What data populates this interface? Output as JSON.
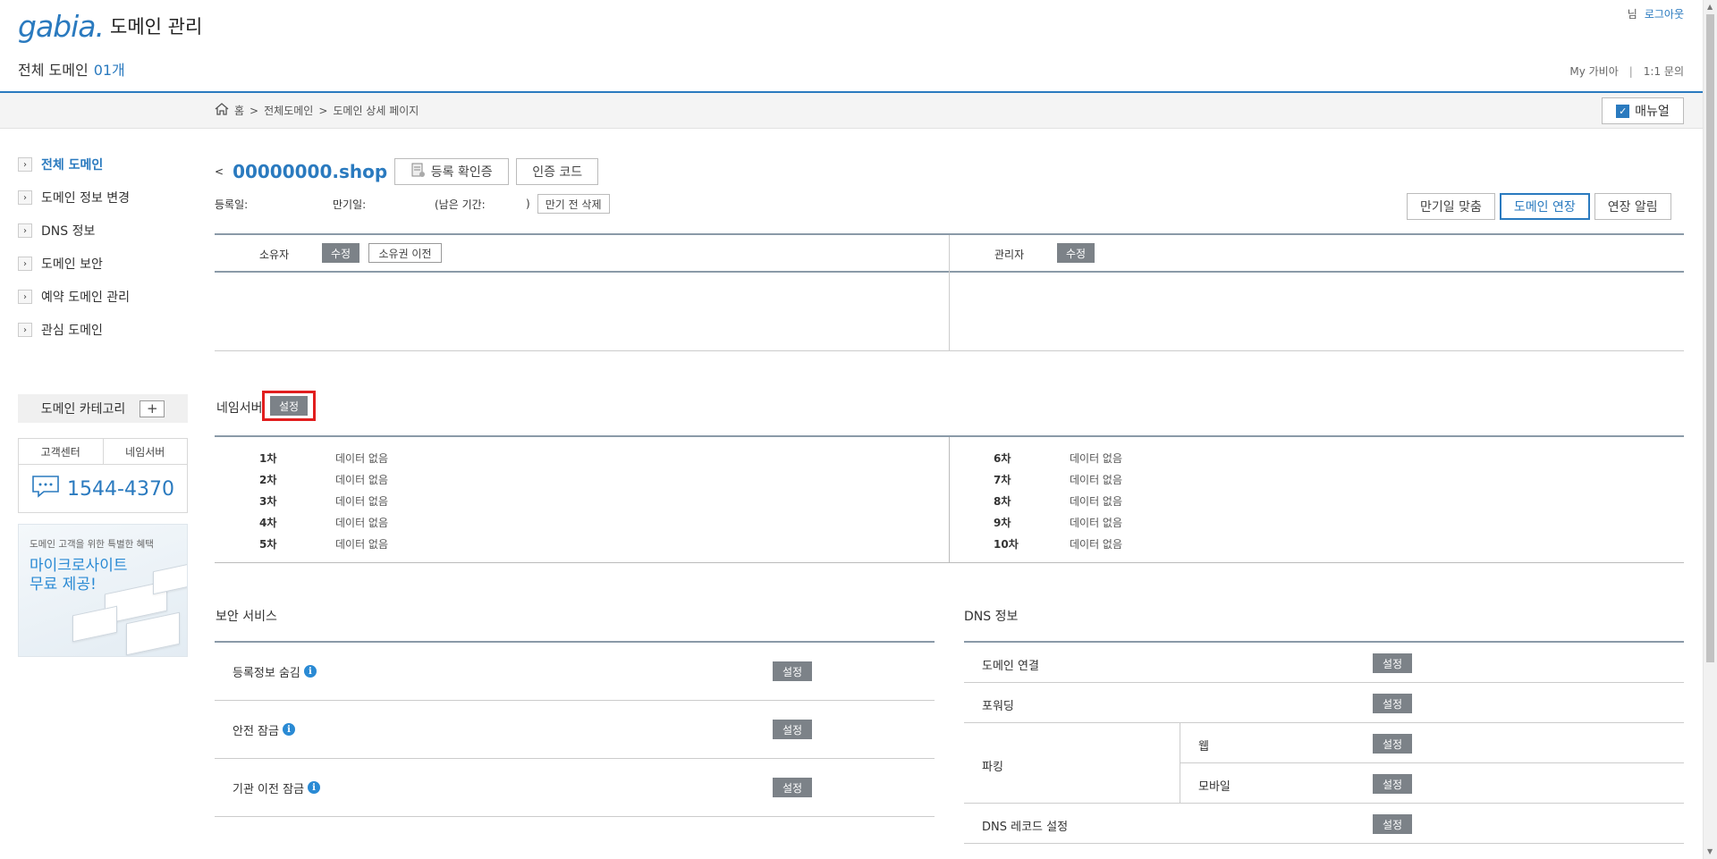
{
  "header": {
    "logo_text": "gabia.",
    "app_title": "도메인 관리",
    "count_label": "전체 도메인",
    "count_value": "01개",
    "user_suffix": "님",
    "logout": "로그아웃",
    "links": [
      "My 가비아",
      "|",
      "1:1 문의"
    ]
  },
  "breadcrumb": {
    "items": [
      "홈",
      ">",
      "전체도메인",
      ">",
      "도메인 상세 페이지"
    ],
    "manual_label": "매뉴얼"
  },
  "sidebar": {
    "items": [
      {
        "label": "전체 도메인"
      },
      {
        "label": "도메인 정보 변경"
      },
      {
        "label": "DNS 정보"
      },
      {
        "label": "도메인 보안"
      },
      {
        "label": "예약 도메인 관리"
      },
      {
        "label": "관심 도메인"
      }
    ],
    "category_label": "도메인 카테고리",
    "category_add": "+",
    "cs_tabs": [
      "고객센터",
      "네임서버"
    ],
    "phone": "1544-4370",
    "promo_small": "도메인 고객을 위한 특별한 혜택",
    "promo_title": "마이크로사이트 무료 제공!"
  },
  "domain": {
    "back": "<",
    "name": "00000000.shop",
    "cert_btn": "등록 확인증",
    "code_btn": "인증 코드",
    "reg_label": "등록일:",
    "exp_label": "만기일:",
    "remain_open": "(남은 기간:",
    "remain_close": ")",
    "delete_btn": "만기 전 삭제",
    "actions": [
      "만기일 맞춤",
      "도메인 연장",
      "연장 알림"
    ]
  },
  "contacts": {
    "owner_label": "소유자",
    "owner_edit": "수정",
    "owner_transfer": "소유권 이전",
    "admin_label": "관리자",
    "admin_edit": "수정"
  },
  "nameserver": {
    "title": "네임서버",
    "set_btn": "설정",
    "left": [
      {
        "idx": "1차",
        "value": "데이터 없음"
      },
      {
        "idx": "2차",
        "value": "데이터 없음"
      },
      {
        "idx": "3차",
        "value": "데이터 없음"
      },
      {
        "idx": "4차",
        "value": "데이터 없음"
      },
      {
        "idx": "5차",
        "value": "데이터 없음"
      }
    ],
    "right": [
      {
        "idx": "6차",
        "value": "데이터 없음"
      },
      {
        "idx": "7차",
        "value": "데이터 없음"
      },
      {
        "idx": "8차",
        "value": "데이터 없음"
      },
      {
        "idx": "9차",
        "value": "데이터 없음"
      },
      {
        "idx": "10차",
        "value": "데이터 없음"
      }
    ]
  },
  "security": {
    "title": "보안 서비스",
    "rows": [
      {
        "label": "등록정보 숨김",
        "btn": "설정"
      },
      {
        "label": "안전 잠금",
        "btn": "설정"
      },
      {
        "label": "기관 이전 잠금",
        "btn": "설정"
      }
    ],
    "info_icon": "i"
  },
  "dns": {
    "title": "DNS 정보",
    "connect": {
      "label": "도메인 연결",
      "btn": "설정"
    },
    "forwarding": {
      "label": "포워딩",
      "btn": "설정"
    },
    "parking": {
      "label": "파킹",
      "web": "웹",
      "web_btn": "설정",
      "mobile": "모바일",
      "mobile_btn": "설정"
    },
    "record": {
      "label": "DNS 레코드 설정",
      "btn": "설정"
    }
  },
  "colors": {
    "accent": "#2a7abf",
    "highlight": "#e11e1e",
    "dark_button": "#7c8288"
  }
}
